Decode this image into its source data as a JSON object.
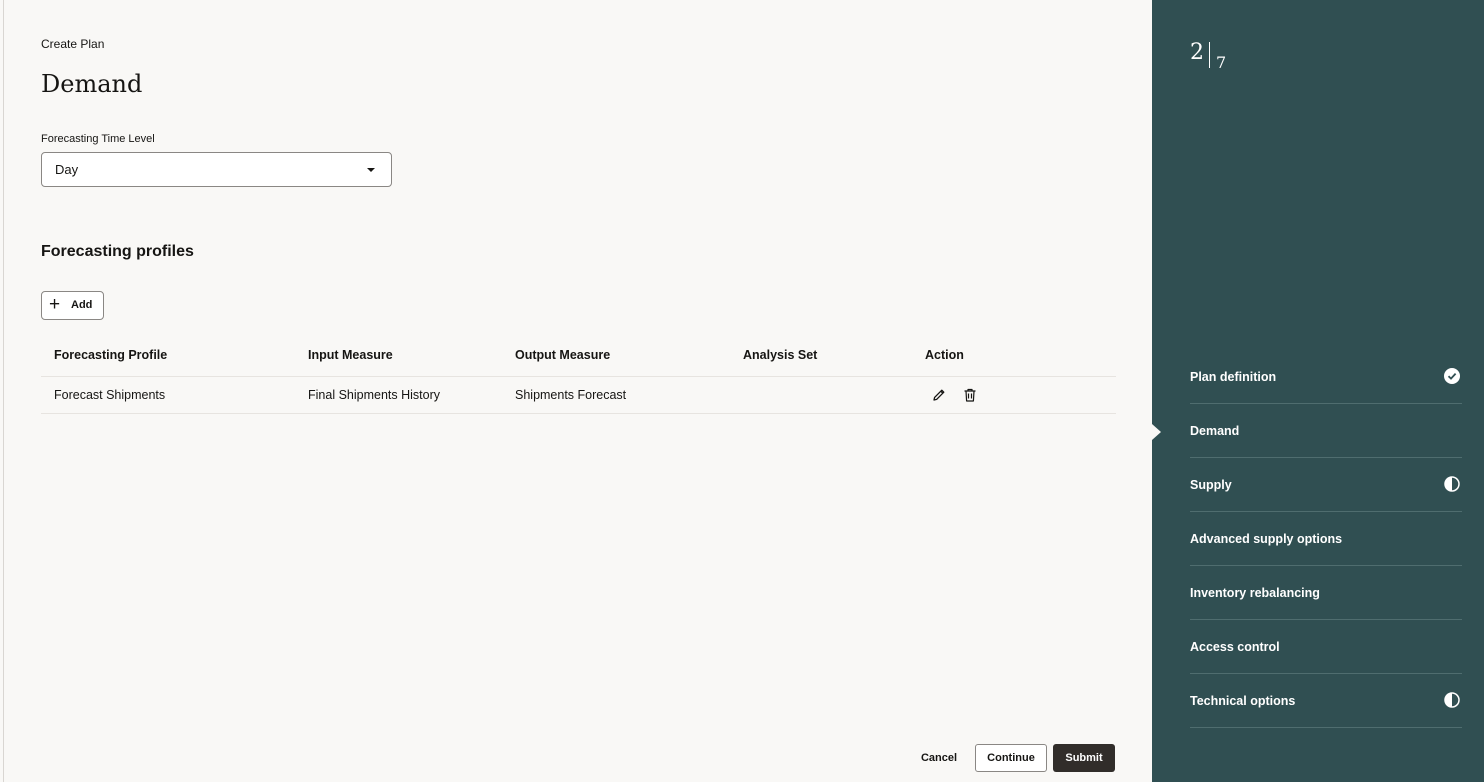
{
  "header": {
    "subtitle": "Create Plan",
    "title": "Demand"
  },
  "time_level": {
    "label": "Forecasting Time Level",
    "value": "Day"
  },
  "profiles": {
    "title": "Forecasting profiles",
    "add_label": "Add",
    "columns": [
      "Forecasting Profile",
      "Input Measure",
      "Output Measure",
      "Analysis Set",
      "Action"
    ],
    "rows": [
      {
        "profile": "Forecast Shipments",
        "input": "Final Shipments History",
        "output": "Shipments Forecast",
        "analysis_set": ""
      }
    ]
  },
  "footer": {
    "cancel": "Cancel",
    "continue": "Continue",
    "submit": "Submit"
  },
  "progress": {
    "current": "2",
    "total": "7"
  },
  "steps": [
    {
      "label": "Plan definition",
      "status": "check-circle-icon"
    },
    {
      "label": "Demand",
      "status": "current"
    },
    {
      "label": "Supply",
      "status": "half-circle-icon"
    },
    {
      "label": "Advanced supply options",
      "status": ""
    },
    {
      "label": "Inventory rebalancing",
      "status": ""
    },
    {
      "label": "Access control",
      "status": ""
    },
    {
      "label": "Technical options",
      "status": "half-circle-icon"
    }
  ],
  "colors": {
    "panel": "#304f52",
    "submit": "#312d2a",
    "background": "#f9f8f6"
  }
}
